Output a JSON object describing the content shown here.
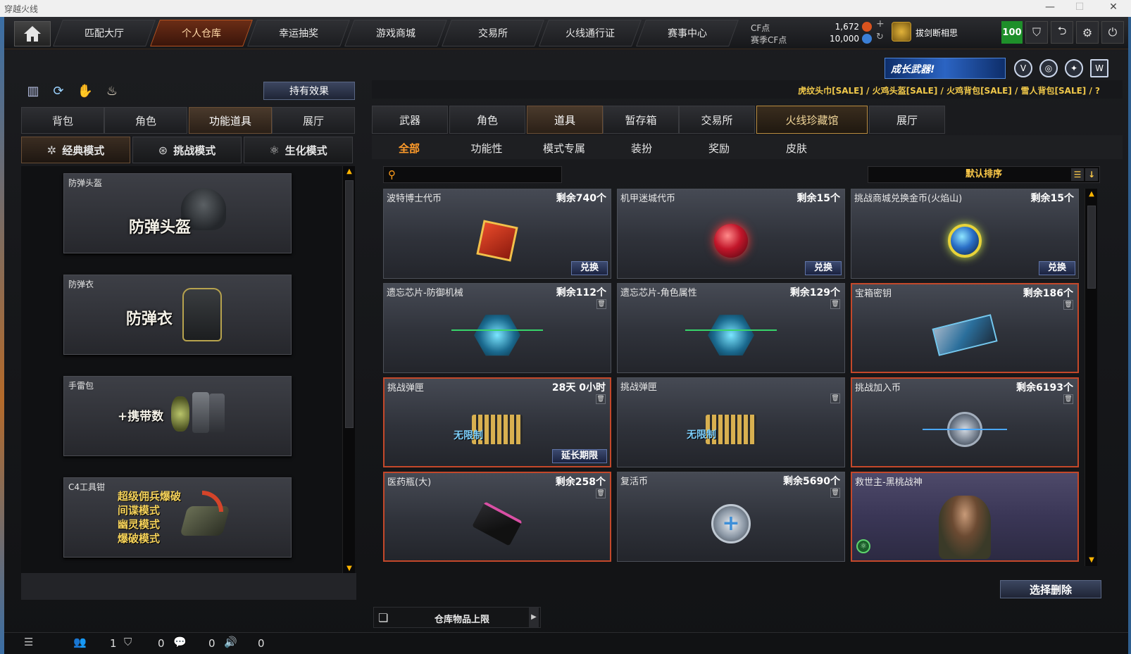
{
  "window": {
    "title": "穿越火线"
  },
  "topnav": {
    "tabs": [
      "匹配大厅",
      "个人仓库",
      "幸运抽奖",
      "游戏商城",
      "交易所",
      "火线通行证",
      "赛事中心"
    ],
    "active_index": 1
  },
  "currency": {
    "cf_label": "CF点",
    "cf_value": "1,672",
    "season_label": "赛季CF点",
    "season_value": "10,000"
  },
  "user": {
    "name": "拔剑断相思",
    "level": "100"
  },
  "promo": {
    "text": "成长武器!"
  },
  "left": {
    "hold_effect_label": "持有效果",
    "tabs": [
      "背包",
      "角色",
      "功能道具",
      "展厅"
    ],
    "active_tab": 2,
    "modes": [
      "经典模式",
      "挑战模式",
      "生化模式"
    ],
    "active_mode": 0,
    "cards": [
      {
        "name": "防弹头盔",
        "title": "防弹头盔"
      },
      {
        "name": "防弹衣",
        "title": "防弹衣"
      },
      {
        "name": "手雷包",
        "title": "+携带数"
      },
      {
        "name": "C4工具钳",
        "lines": [
          "超级佣兵爆破",
          "间谍模式",
          "幽灵模式",
          "爆破模式"
        ]
      }
    ]
  },
  "right": {
    "sale_text": "虎纹头巾[SALE] / 火鸡头盔[SALE] / 火鸡背包[SALE] / 雪人背包[SALE] / ?",
    "tabs": [
      "武器",
      "角色",
      "道具",
      "暂存箱",
      "交易所",
      "火线珍藏馆",
      "展厅"
    ],
    "active_tab": 2,
    "subtabs": [
      "全部",
      "功能性",
      "模式专属",
      "装扮",
      "奖励",
      "皮肤"
    ],
    "active_sub": 0,
    "search_placeholder": "",
    "sort_label": "默认排序",
    "items": [
      {
        "name": "波特博士代币",
        "qty": "剩余740个",
        "action": "兑换",
        "icon": "gift-box-icon"
      },
      {
        "name": "机甲迷城代币",
        "qty": "剩余15个",
        "action": "兑换",
        "icon": "red-coin-icon"
      },
      {
        "name": "挑战商城兑换金币(火焰山)",
        "qty": "剩余15个",
        "action": "兑换",
        "icon": "gold-coin-icon"
      },
      {
        "name": "遗忘芯片-防御机械",
        "qty": "剩余112个",
        "icon": "chip-icon"
      },
      {
        "name": "遗忘芯片-角色属性",
        "qty": "剩余129个",
        "icon": "chip-icon"
      },
      {
        "name": "宝箱密钥",
        "qty": "剩余186个",
        "icon": "key-card-icon"
      },
      {
        "name": "挑战弹匣",
        "qty": "28天 0小时",
        "action": "延长期限",
        "icon": "ammo-icon",
        "badge": "无限制"
      },
      {
        "name": "挑战弹匣",
        "qty": "",
        "icon": "ammo-icon",
        "badge": "无限制"
      },
      {
        "name": "挑战加入币",
        "qty": "剩余6193个",
        "icon": "join-coin-icon"
      },
      {
        "name": "医药瓶(大)",
        "qty": "剩余258个",
        "icon": "medkit-gun-icon"
      },
      {
        "name": "复活币",
        "qty": "剩余5690个",
        "icon": "revive-coin-icon"
      },
      {
        "name": "救世主-黑桃战神",
        "qty": "",
        "icon": "hero-portrait-icon"
      }
    ],
    "delete_label": "选择删除",
    "storage_limit_label": "仓库物品上限"
  },
  "status": {
    "values": [
      "1",
      "0",
      "0",
      "0"
    ]
  }
}
